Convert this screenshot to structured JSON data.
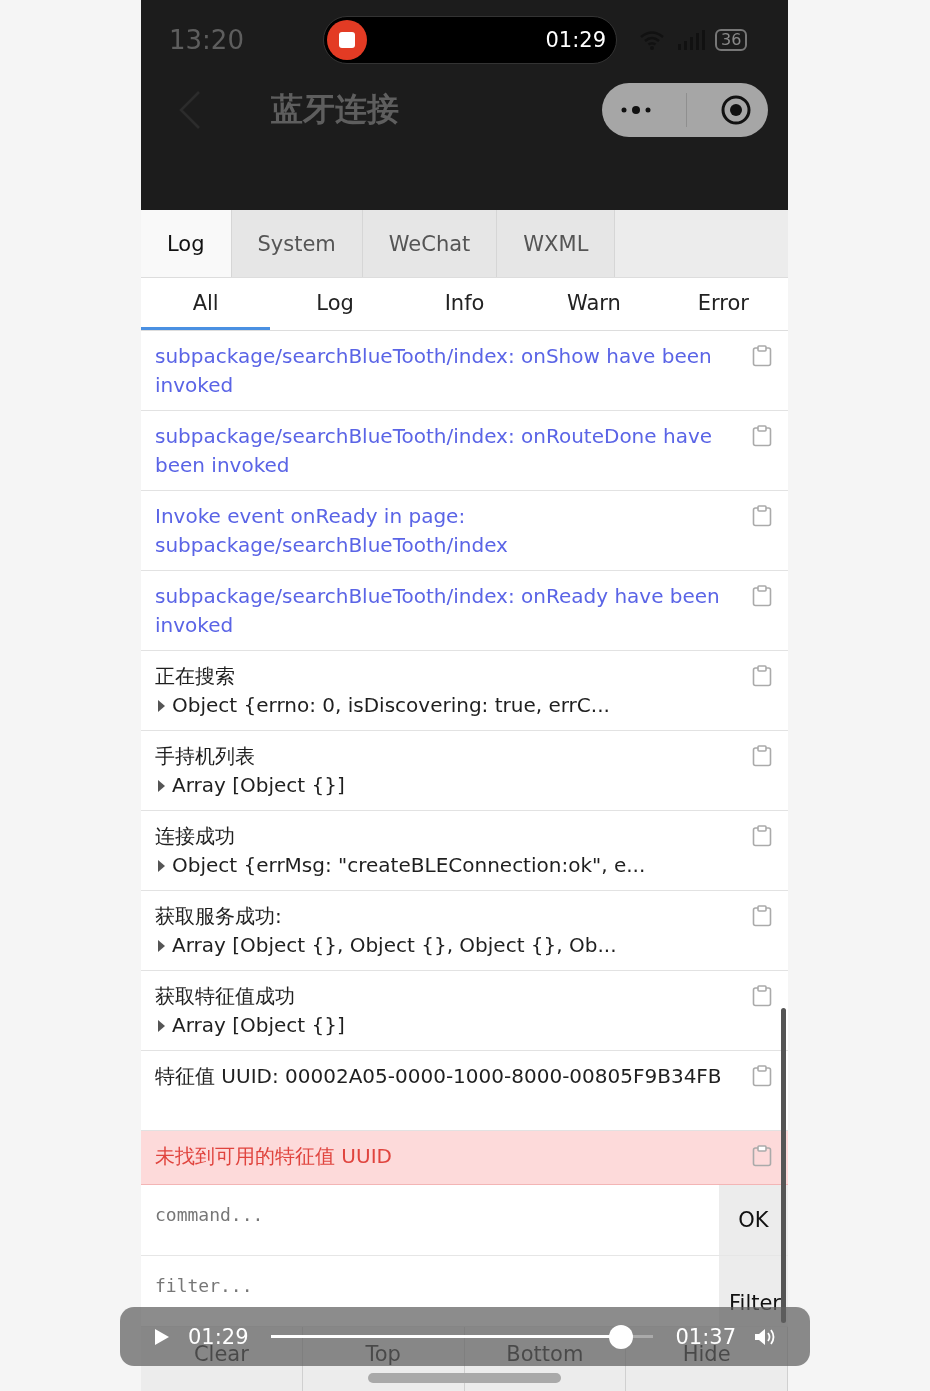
{
  "status_bar": {
    "time": "13:20",
    "recording_time": "01:29",
    "battery": "36"
  },
  "nav": {
    "title": "蓝牙连接"
  },
  "tabs": [
    {
      "label": "Log",
      "selected": true
    },
    {
      "label": "System",
      "selected": false
    },
    {
      "label": "WeChat",
      "selected": false
    },
    {
      "label": "WXML",
      "selected": false
    }
  ],
  "filters": [
    {
      "label": "All",
      "selected": true
    },
    {
      "label": "Log",
      "selected": false
    },
    {
      "label": "Info",
      "selected": false
    },
    {
      "label": "Warn",
      "selected": false
    },
    {
      "label": "Error",
      "selected": false
    }
  ],
  "entries": [
    {
      "kind": "info",
      "text": "subpackage/searchBlueTooth/index: onShow have been invoked"
    },
    {
      "kind": "info",
      "text": "subpackage/searchBlueTooth/index: onRouteDone have been invoked"
    },
    {
      "kind": "info",
      "text": "Invoke event onReady in page: subpackage/searchBlueTooth/index"
    },
    {
      "kind": "info",
      "text": "subpackage/searchBlueTooth/index: onReady have been invoked"
    },
    {
      "kind": "log",
      "text": "正在搜索",
      "detail": "Object {errno: 0, isDiscovering: true, errC...",
      "expanded": false
    },
    {
      "kind": "log",
      "text": "手持机列表",
      "detail": "Array [Object {}]",
      "expanded": false
    },
    {
      "kind": "log",
      "text": "连接成功",
      "detail": "Object {errMsg: \"createBLEConnection:ok\", e...",
      "expanded": false
    },
    {
      "kind": "log",
      "text": "获取服务成功:",
      "detail": "Array [Object {}, Object {}, Object {}, Ob...",
      "expanded": false
    },
    {
      "kind": "log",
      "text": "获取特征值成功",
      "detail": "Array [Object {}]",
      "expanded": false
    },
    {
      "kind": "log",
      "text": "特征值 UUID: 00002A05-0000-1000-8000-00805F9B34FB"
    },
    {
      "kind": "error",
      "text": "未找到可用的特征值 UUID"
    }
  ],
  "command": {
    "placeholder": "command...",
    "button": "OK"
  },
  "filter": {
    "placeholder": "filter...",
    "button": "Filter"
  },
  "actions": [
    "Clear",
    "Top",
    "Bottom",
    "Hide"
  ],
  "player": {
    "current": "01:29",
    "total": "01:37",
    "level": 0.915
  }
}
